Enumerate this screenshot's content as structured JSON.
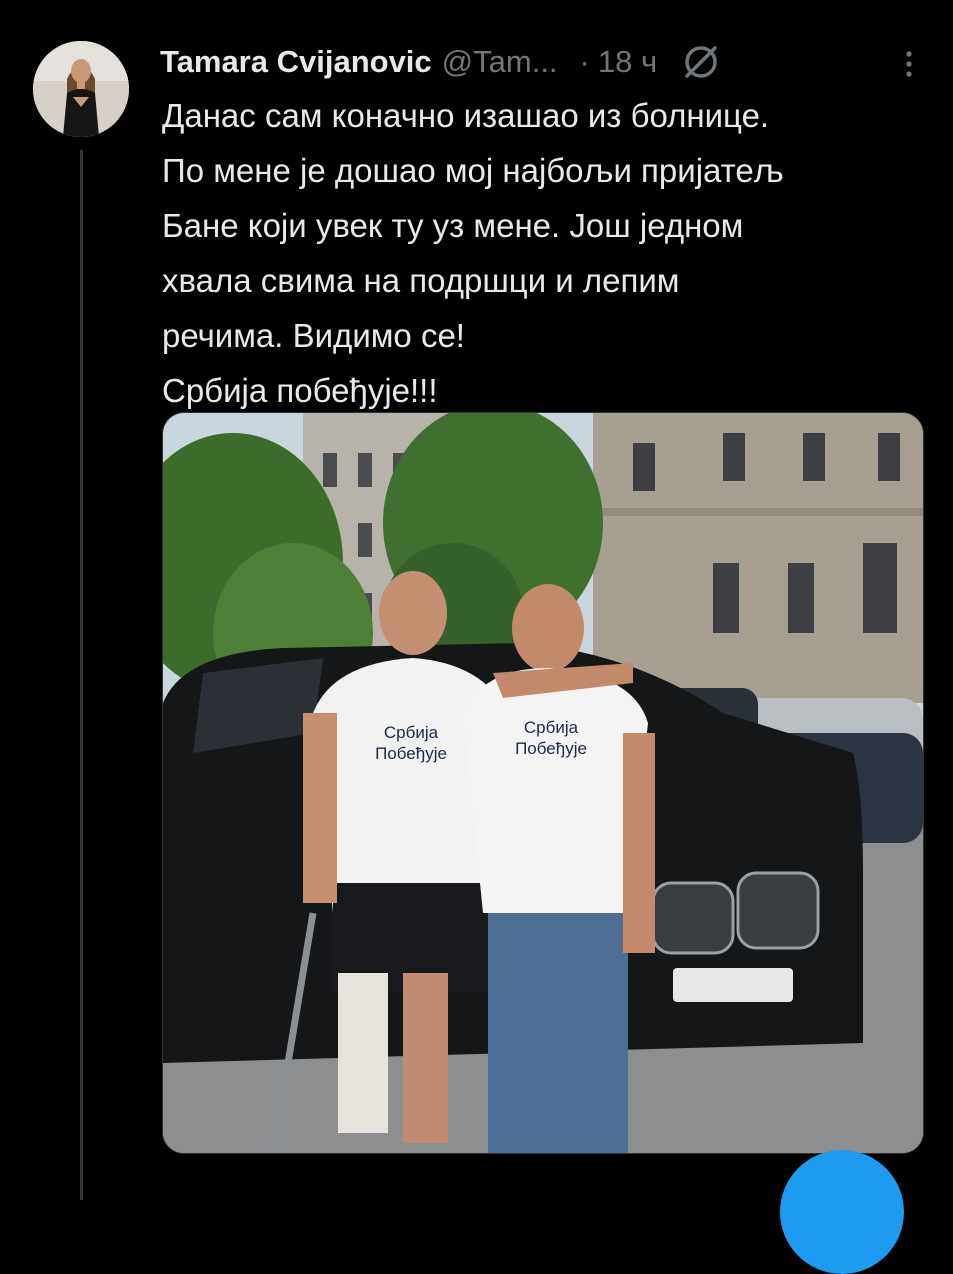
{
  "tweet": {
    "author_name": "Tamara Cvijanovic",
    "author_handle": "@Tam...",
    "separator": "·",
    "timestamp": "18 ч",
    "text_lines": [
      "Данас сам коначно изашао из болнице.",
      "По мене је дошао мој најбољи пријатељ",
      "Бане који увек ту уз мене. Још једном",
      "хвала свима на подршци и лепим",
      "речима. Видимо се!",
      "Србија побеђује!!!"
    ],
    "media": {
      "shirt_text_line1": "Србија",
      "shirt_text_line2": "Побеђује"
    }
  },
  "icons": {
    "grok": "grok-icon",
    "more": "more-icon"
  },
  "colors": {
    "background": "#000000",
    "text_primary": "#e7e9ea",
    "text_secondary": "#71767b",
    "accent": "#1d9bf0"
  }
}
